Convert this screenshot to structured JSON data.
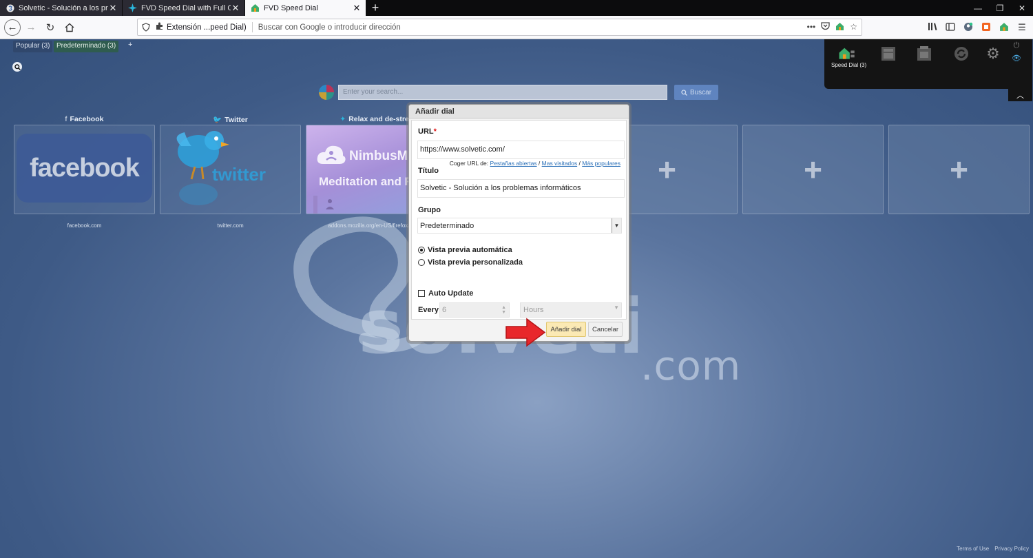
{
  "browser": {
    "tabs": [
      {
        "title": "Solvetic - Solución a los proble",
        "active": false
      },
      {
        "title": "FVD Speed Dial with Full Online",
        "active": false
      },
      {
        "title": "FVD Speed Dial",
        "active": true
      }
    ],
    "url_extension_label": "Extensión ...peed Dial)",
    "url_placeholder": "Buscar con Google o introducir dirección"
  },
  "page": {
    "groups": [
      {
        "label": "Popular (3)"
      },
      {
        "label": "Predeterminado (3)"
      }
    ],
    "add_group": "+",
    "search_placeholder": "Enter your search...",
    "search_button": "Buscar",
    "dials": [
      {
        "label": "Facebook",
        "url": "facebook.com",
        "thumb_text": "facebook"
      },
      {
        "label": "Twitter",
        "url": "twitter.com",
        "thumb_text": "twitter"
      },
      {
        "label": "Relax and de-stres",
        "url": "addons.mozilla.org/en-US/firefox/addon",
        "thumb_title": "NimbusM",
        "thumb_sub": "Meditation and R"
      }
    ],
    "watermark": ".com",
    "speed_dial_panel": {
      "label": "Speed Dial (3)"
    },
    "footer": {
      "terms": "Terms of Use",
      "privacy": "Privacy Policy"
    }
  },
  "modal": {
    "title": "Añadir dial",
    "url_label": "URL",
    "url_required": "*",
    "url_value": "https://www.solvetic.com/",
    "grab_prefix": "Coger URL de:",
    "grab_links": [
      "Pestañas abiertas",
      "Mas visitados",
      "Más populares"
    ],
    "title_label": "Título",
    "title_value": "Solvetic - Solución a los problemas informáticos",
    "group_label": "Grupo",
    "group_value": "Predeterminado",
    "preview_auto": "Vista previa automática",
    "preview_custom": "Vista previa personalizada",
    "auto_update": "Auto Update",
    "every_label": "Every",
    "every_value": "6",
    "every_unit": "Hours",
    "btn_add": "Añadir dial",
    "btn_cancel": "Cancelar"
  },
  "colors": {
    "accent_red": "#e8272b",
    "modal_primary": "#fbe9b4",
    "page_bg": "#4a6694"
  }
}
